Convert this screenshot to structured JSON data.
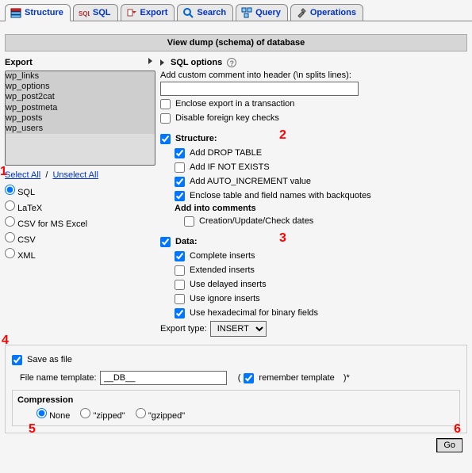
{
  "tabs": [
    {
      "label": "Structure"
    },
    {
      "label": "SQL"
    },
    {
      "label": "Export"
    },
    {
      "label": "Search"
    },
    {
      "label": "Query"
    },
    {
      "label": "Operations"
    }
  ],
  "title": "View dump (schema) of database",
  "export": {
    "legend": "Export",
    "tables": [
      "wp_links",
      "wp_options",
      "wp_post2cat",
      "wp_postmeta",
      "wp_posts",
      "wp_users"
    ],
    "select_all": "Select All",
    "unselect_all": "Unselect All",
    "sep": "/",
    "formats": {
      "sql": "SQL",
      "latex": "LaTeX",
      "csv_excel": "CSV for MS Excel",
      "csv": "CSV",
      "xml": "XML"
    }
  },
  "sql": {
    "legend": "SQL options",
    "comment_label": "Add custom comment into header (\\n splits lines):",
    "comment_value": "",
    "enclose_tx": "Enclose export in a transaction",
    "disable_fk": "Disable foreign key checks",
    "structure": {
      "legend": "Structure:",
      "drop": "Add DROP TABLE",
      "ifnot": "Add IF NOT EXISTS",
      "autoinc": "Add AUTO_INCREMENT value",
      "backquote": "Enclose table and field names with backquotes",
      "comments_legend": "Add into comments",
      "creation": "Creation/Update/Check dates"
    },
    "data": {
      "legend": "Data:",
      "complete": "Complete inserts",
      "extended": "Extended inserts",
      "delayed": "Use delayed inserts",
      "ignore": "Use ignore inserts",
      "hex": "Use hexadecimal for binary fields",
      "export_type_label": "Export type:",
      "export_type_value": "INSERT"
    }
  },
  "save": {
    "legend": "Save as file",
    "fname_label": "File name template:",
    "fname_value": "__DB__",
    "remember": "remember template",
    "remember_suffix": ")*",
    "paren_open": "(",
    "compression_legend": "Compression",
    "none": "None",
    "zipped": "\"zipped\"",
    "gzipped": "\"gzipped\""
  },
  "go_label": "Go",
  "annotations": {
    "a1": "1",
    "a2": "2",
    "a3": "3",
    "a4": "4",
    "a5": "5",
    "a6": "6"
  }
}
